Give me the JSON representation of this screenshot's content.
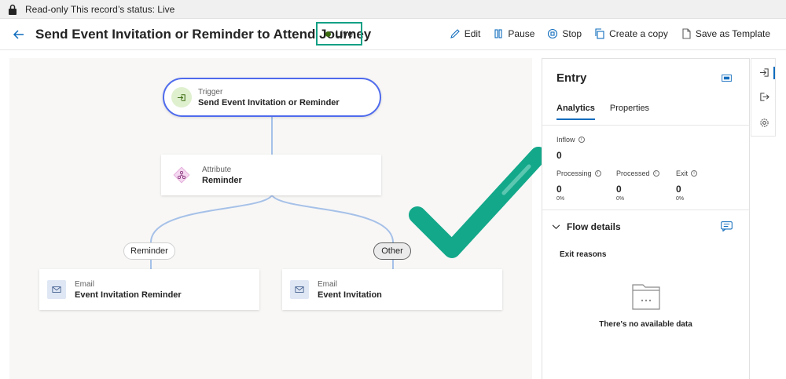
{
  "notice": {
    "text": "Read-only This record’s status: Live"
  },
  "header": {
    "title": "Send Event Invitation or Reminder to Attend Journey",
    "status": "Live",
    "actions": [
      {
        "label": "Edit",
        "icon": "edit-icon"
      },
      {
        "label": "Pause",
        "icon": "pause-icon"
      },
      {
        "label": "Stop",
        "icon": "stop-icon"
      },
      {
        "label": "Create a copy",
        "icon": "copy-icon"
      },
      {
        "label": "Save as Template",
        "icon": "template-icon"
      }
    ]
  },
  "flow": {
    "trigger": {
      "label": "Trigger",
      "name": "Send Event Invitation or Reminder"
    },
    "attribute": {
      "label": "Attribute",
      "name": "Reminder"
    },
    "branches": [
      {
        "pill": "Reminder",
        "node_label": "Email",
        "node_name": "Event Invitation Reminder"
      },
      {
        "pill": "Other",
        "node_label": "Email",
        "node_name": "Event Invitation"
      }
    ]
  },
  "panel": {
    "title": "Entry",
    "tabs": [
      "Analytics",
      "Properties"
    ],
    "active_tab": "Analytics",
    "inflow": {
      "label": "Inflow",
      "value": "0"
    },
    "metrics": [
      {
        "label": "Processing",
        "value": "0",
        "percent": "0%"
      },
      {
        "label": "Processed",
        "value": "0",
        "percent": "0%"
      },
      {
        "label": "Exit",
        "value": "0",
        "percent": "0%"
      }
    ],
    "flow_details": "Flow details",
    "exit_reasons": "Exit reasons",
    "empty_text": "There's no available data"
  },
  "colors": {
    "accent": "#0f6cbd",
    "trigger_border": "#4f6bed",
    "live_outline": "#14a085",
    "checkmark": "#13a88a",
    "connector": "#a6c1e8"
  }
}
